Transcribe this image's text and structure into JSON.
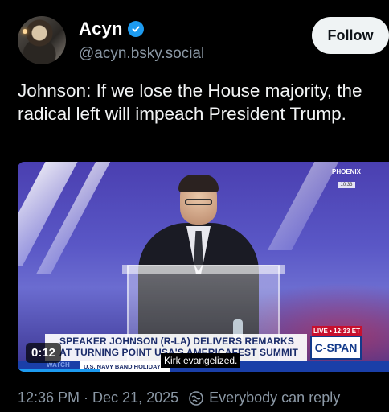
{
  "author": {
    "name": "Acyn",
    "handle": "@acyn.bsky.social",
    "verified_icon": "verified-check-icon"
  },
  "follow_label": "Follow",
  "post_text": "Johnson: If we lose the House majority, the radical left will impeach President Trump.",
  "video": {
    "duration": "0:12",
    "caption": "Kirk evangelized.",
    "broadcast": {
      "location": "PHOENIX",
      "location_time": "10:33",
      "live_label": "LIVE • 12:33 ET",
      "network": "C-SPAN",
      "headline": "SPEAKER JOHNSON (R-LA) DELIVERS REMARKS AT TURNING POINT USA'S AMERICAFEST SUMMIT",
      "watch_label": "WATCH",
      "ticker": "U.S. NAVY BAND HOLIDAY"
    },
    "progress_fraction": 0.22
  },
  "meta": {
    "timestamp": "12:36 PM · Dec 21, 2025",
    "reply_setting": "Everybody can reply",
    "reply_icon": "globe-reply-icon"
  },
  "colors": {
    "accent": "#1d9bf0",
    "background": "#000000",
    "muted_text": "#8b98a5"
  }
}
